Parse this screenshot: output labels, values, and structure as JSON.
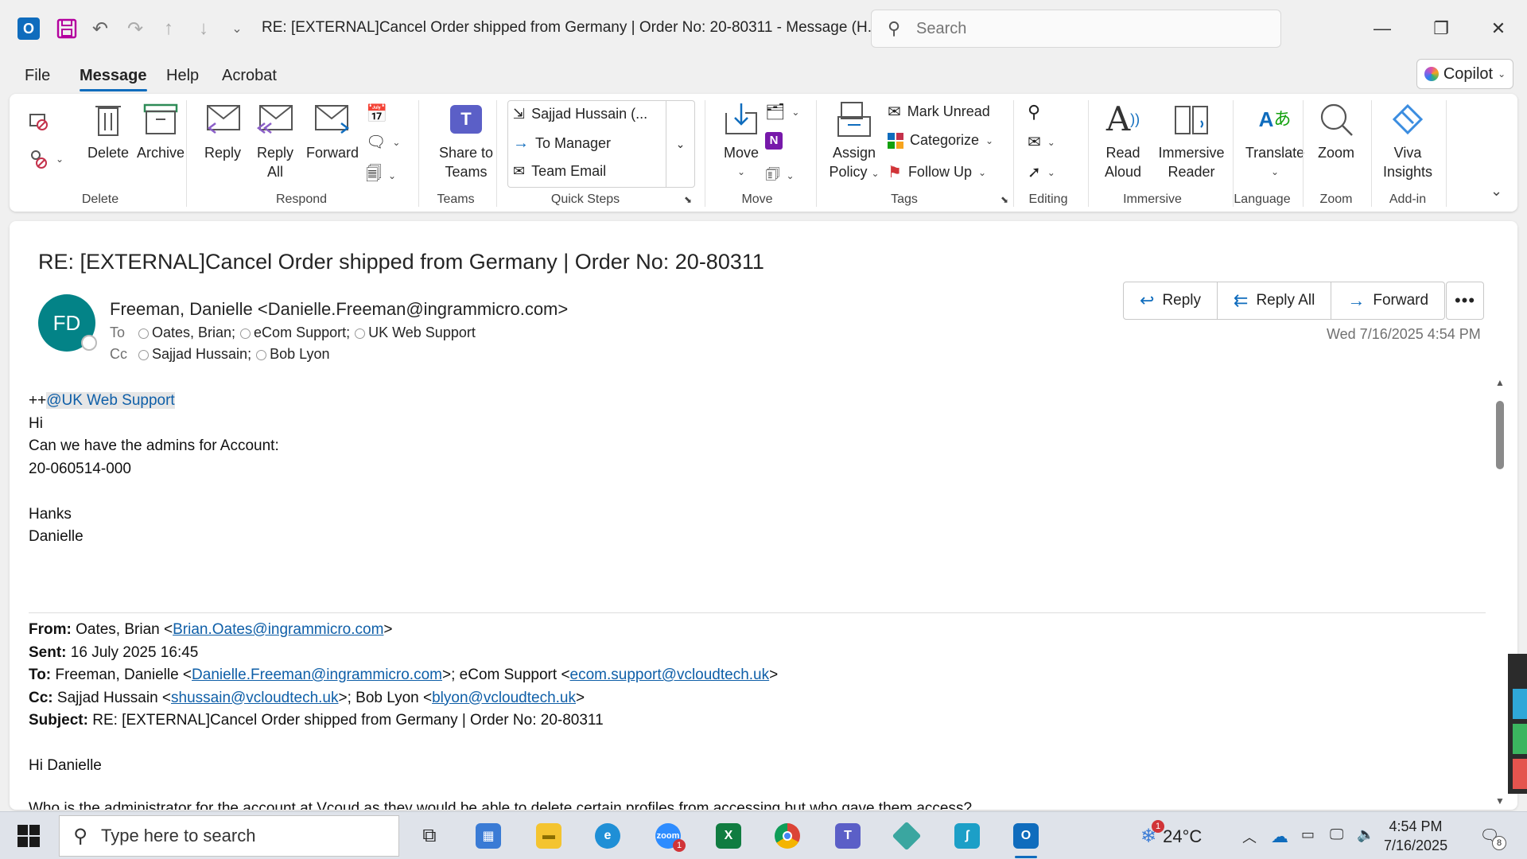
{
  "window": {
    "title": "RE: [EXTERNAL]Cancel Order shipped from Germany | Order No: 20-80311  -  Message (H...",
    "search_placeholder": "Search"
  },
  "menu": {
    "tabs": [
      "File",
      "Message",
      "Help",
      "Acrobat"
    ],
    "active_tab": "Message",
    "copilot_label": "Copilot"
  },
  "ribbon": {
    "groups": {
      "delete": "Delete",
      "respond": "Respond",
      "teams": "Teams",
      "quick_steps": "Quick Steps",
      "move": "Move",
      "tags": "Tags",
      "editing": "Editing",
      "immersive": "Immersive",
      "language": "Language",
      "zoom": "Zoom",
      "addin": "Add-in"
    },
    "buttons": {
      "delete": "Delete",
      "archive": "Archive",
      "reply": "Reply",
      "reply_all_1": "Reply",
      "reply_all_2": "All",
      "forward": "Forward",
      "share_teams_1": "Share to",
      "share_teams_2": "Teams",
      "move": "Move",
      "assign_policy_1": "Assign",
      "assign_policy_2": "Policy",
      "mark_unread": "Mark Unread",
      "categorize": "Categorize",
      "follow_up": "Follow Up",
      "read_aloud_1": "Read",
      "read_aloud_2": "Aloud",
      "immersive_reader_1": "Immersive",
      "immersive_reader_2": "Reader",
      "translate": "Translate",
      "zoom": "Zoom",
      "viva_1": "Viva",
      "viva_2": "Insights"
    },
    "quick_steps": [
      "Sajjad Hussain (...",
      "To Manager",
      "Team Email"
    ]
  },
  "message": {
    "subject": "RE: [EXTERNAL]Cancel Order shipped from Germany | Order No: 20-80311",
    "avatar_initials": "FD",
    "sender": "Freeman, Danielle <Danielle.Freeman@ingrammicro.com>",
    "to_label": "To",
    "to": [
      "Oates, Brian;",
      "eCom Support;",
      "UK  Web Support"
    ],
    "cc_label": "Cc",
    "cc": [
      "Sajjad Hussain;",
      "Bob Lyon"
    ],
    "actions": {
      "reply": "Reply",
      "reply_all": "Reply All",
      "forward": "Forward"
    },
    "datetime": "Wed 7/16/2025 4:54 PM",
    "body": {
      "mention_prefix": "++",
      "mention": "@UK  Web Support",
      "lines": [
        "Hi",
        "Can we have the admins for Account:",
        "20-060514-000",
        "",
        "Hanks",
        "Danielle"
      ]
    },
    "quoted": {
      "from_label": "From:",
      "from_name": " Oates, Brian <",
      "from_email": "Brian.Oates@ingrammicro.com",
      "sent_label": "Sent:",
      "sent": " 16 July 2025 16:45",
      "to_label": "To:",
      "to_name1": " Freeman, Danielle <",
      "to_email1": "Danielle.Freeman@ingrammicro.com",
      "to_name2": ">; eCom Support <",
      "to_email2": "ecom.support@vcloudtech.uk",
      "cc_label": "Cc:",
      "cc_name1": " Sajjad Hussain <",
      "cc_email1": "shussain@vcloudtech.uk",
      "cc_name2": ">; Bob Lyon <",
      "cc_email2": "blyon@vcloudtech.uk",
      "subject_label": "Subject:",
      "subject": " RE: [EXTERNAL]Cancel Order shipped from Germany | Order No: 20-80311",
      "greeting": "Hi Danielle",
      "cut_line": "Who is the administrator for the account at Vcoud as they would be able to delete certain profiles from accessing but who gave them access?"
    }
  },
  "taskbar": {
    "search_placeholder": "Type here to search",
    "temperature": "24°C",
    "time": "4:54 PM",
    "date": "7/16/2025",
    "zoom_badge": "1",
    "weather_badge": "1",
    "notification_count": "8"
  }
}
